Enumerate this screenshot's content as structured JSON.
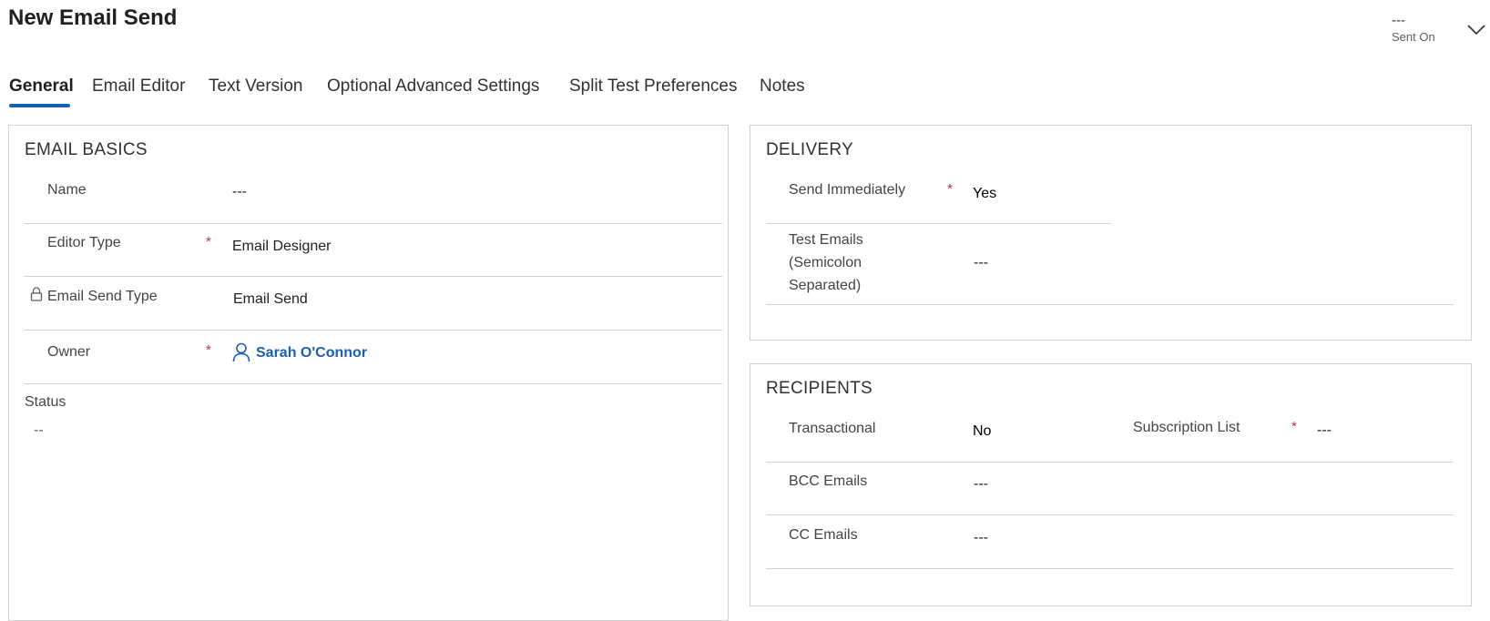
{
  "header": {
    "title": "New Email Send",
    "sent_on_value": "---",
    "sent_on_label": "Sent On"
  },
  "tabs": [
    {
      "label": "General",
      "active": true
    },
    {
      "label": "Email Editor"
    },
    {
      "label": "Text Version"
    },
    {
      "label": "Optional Advanced Settings"
    },
    {
      "label": "Split Test Preferences"
    },
    {
      "label": "Notes"
    }
  ],
  "email_basics": {
    "title": "EMAIL BASICS",
    "name": {
      "label": "Name",
      "value": "---"
    },
    "editor_type": {
      "label": "Editor Type",
      "required": "*",
      "value": "Email Designer"
    },
    "email_send_type": {
      "label": "Email Send Type",
      "value": "Email Send",
      "locked": true
    },
    "owner": {
      "label": "Owner",
      "required": "*",
      "value": "Sarah O'Connor"
    },
    "status": {
      "label": "Status",
      "value": "--"
    }
  },
  "delivery": {
    "title": "DELIVERY",
    "send_immediately": {
      "label": "Send Immediately",
      "required": "*",
      "value": "Yes"
    },
    "test_emails": {
      "label_line1": "Test Emails",
      "label_line2": "(Semicolon",
      "label_line3": "Separated)",
      "value": "---"
    }
  },
  "recipients": {
    "title": "RECIPIENTS",
    "transactional": {
      "label": "Transactional",
      "value": "No"
    },
    "subscription_list": {
      "label": "Subscription List",
      "required": "*",
      "value": "---"
    },
    "bcc_emails": {
      "label": "BCC Emails",
      "value": "---"
    },
    "cc_emails": {
      "label": "CC Emails",
      "value": "---"
    }
  },
  "colors": {
    "accent": "#1a5fb4",
    "required": "#c4314b",
    "border": "#d1d1d1"
  }
}
